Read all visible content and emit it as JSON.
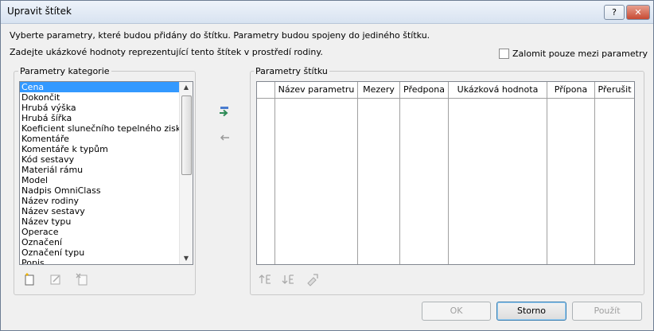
{
  "window": {
    "title": "Upravit štítek",
    "help_label": "?",
    "close_label": "✕"
  },
  "instructions": {
    "line1": "Vyberte parametry, které budou přidány do štítku. Parametry budou spojeny do jediného štítku.",
    "line2": "Zadejte ukázkové hodnoty reprezentující tento štítek v prostředí rodiny."
  },
  "wrap_checkbox": {
    "label": "Zalomit pouze mezi parametry",
    "checked": false
  },
  "category_params": {
    "legend": "Parametry kategorie",
    "selected_index": 0,
    "items": [
      "Cena",
      "Dokončit",
      "Hrubá výška",
      "Hrubá šířka",
      "Koeficient slunečního tepelného zisku",
      "Komentáře",
      "Komentáře k typům",
      "Kód sestavy",
      "Materiál rámu",
      "Model",
      "Nadpis OmniClass",
      "Název rodiny",
      "Název sestavy",
      "Název typu",
      "Operace",
      "Označení",
      "Označení typu",
      "Popis"
    ],
    "icons": [
      "new-parameter-icon",
      "edit-parameter-icon",
      "delete-parameter-icon"
    ]
  },
  "transfer": {
    "add_icon": "add-to-label-arrow-icon",
    "remove_icon": "remove-from-label-arrow-icon"
  },
  "label_params": {
    "legend": "Parametry štítku",
    "columns": [
      "Název parametru",
      "Mezery",
      "Předpona",
      "Ukázková hodnota",
      "Přípona",
      "Přerušit"
    ],
    "rows": [],
    "icons": [
      "move-up-icon",
      "move-down-icon",
      "format-parameters-icon"
    ]
  },
  "footer": {
    "ok_label": "OK",
    "cancel_label": "Storno",
    "apply_label": "Použít"
  },
  "colors": {
    "selection": "#3399ff",
    "dialog_bg": "#f0f0f0",
    "accent_green": "#2e8b57"
  }
}
